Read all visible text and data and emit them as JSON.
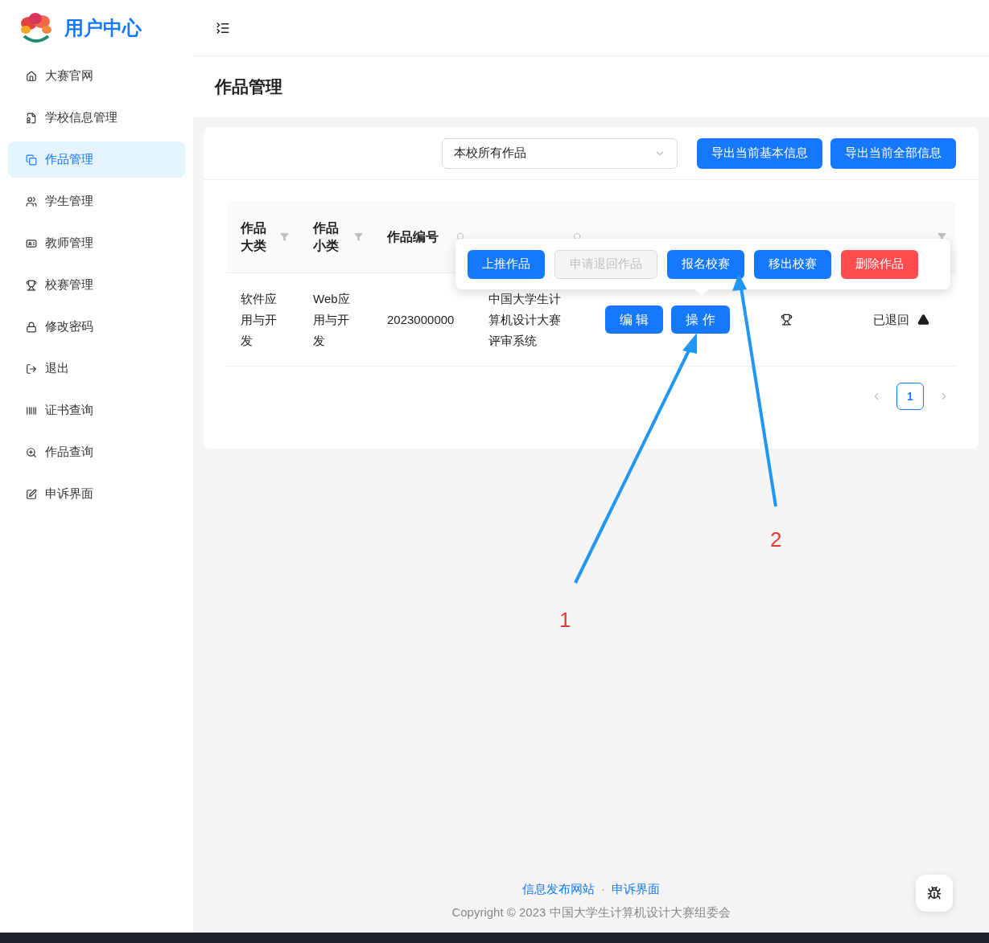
{
  "sidebar": {
    "title": "用户中心",
    "items": [
      {
        "label": "大赛官网",
        "selected": false
      },
      {
        "label": "学校信息管理",
        "selected": false
      },
      {
        "label": "作品管理",
        "selected": true
      },
      {
        "label": "学生管理",
        "selected": false
      },
      {
        "label": "教师管理",
        "selected": false
      },
      {
        "label": "校赛管理",
        "selected": false
      },
      {
        "label": "修改密码",
        "selected": false
      },
      {
        "label": "退出",
        "selected": false
      },
      {
        "label": "证书查询",
        "selected": false
      },
      {
        "label": "作品查询",
        "selected": false
      },
      {
        "label": "申诉界面",
        "selected": false
      }
    ]
  },
  "page_title": "作品管理",
  "toolbar": {
    "select_value": "本校所有作品",
    "buttons": [
      "导出当前基本信息",
      "导出当前全部信息"
    ]
  },
  "table": {
    "columns": [
      {
        "label": "作品大类",
        "kind": "filter"
      },
      {
        "label": "作品小类",
        "kind": "filter"
      },
      {
        "label": "作品编号",
        "kind": "search"
      },
      {
        "kind": "search"
      },
      {
        "kind": "plain"
      },
      {
        "kind": "plain"
      },
      {
        "kind": "filter"
      }
    ],
    "rows": [
      {
        "category": "软件应用与开发",
        "subcategory": "Web应用与开发",
        "number": "2023000000",
        "name": "中国大学生计算机设计大赛评审系统",
        "actions": [
          "编 辑",
          "操 作"
        ],
        "status": "已退回"
      }
    ]
  },
  "popover": {
    "buttons": [
      {
        "label": "上推作品",
        "kind": "primary"
      },
      {
        "label": "申请退回作品",
        "kind": "disabled"
      },
      {
        "label": "报名校赛",
        "kind": "primary"
      },
      {
        "label": "移出校赛",
        "kind": "primary"
      },
      {
        "label": "删除作品",
        "kind": "danger"
      }
    ]
  },
  "pagination": {
    "pages": [
      {
        "label": "1",
        "selected": true
      }
    ]
  },
  "footer": {
    "links": [
      "信息发布网站",
      "申诉界面"
    ],
    "separator": "·",
    "copyright": "Copyright © 2023 中国大学生计算机设计大赛组委会"
  },
  "annotations": [
    {
      "label": "1"
    },
    {
      "label": "2"
    }
  ]
}
